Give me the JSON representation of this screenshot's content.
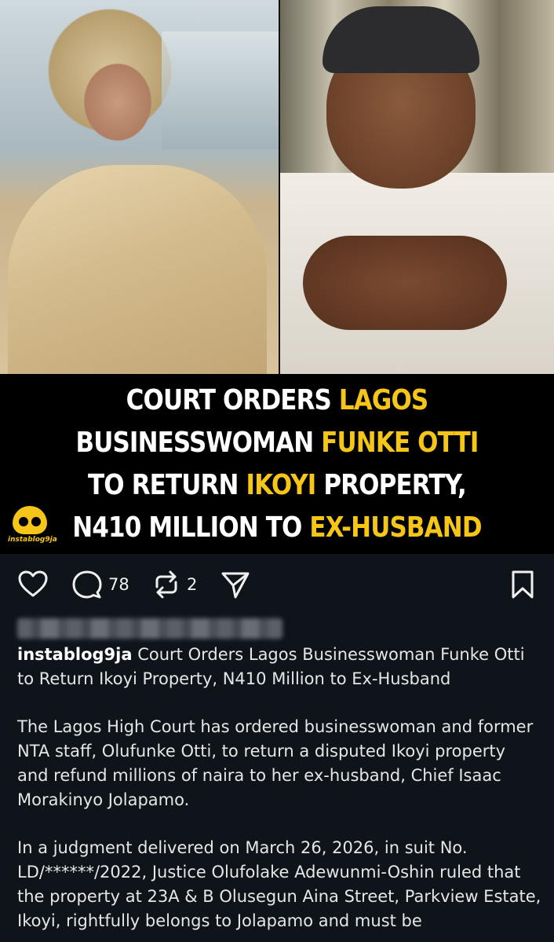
{
  "headline": {
    "line1_white": "COURT ORDERS ",
    "line1_yellow": "LAGOS",
    "line2_white": "BUSINESSWOMAN ",
    "line2_yellow": "FUNKE OTTI",
    "line3_white_a": "TO RETURN ",
    "line3_yellow": "IKOYI",
    "line3_white_b": " PROPERTY,",
    "line4_white": "N410 MILLION TO ",
    "line4_yellow": "EX-HUSBAND"
  },
  "logo": {
    "text": "instablog9ja"
  },
  "actions": {
    "comments_count": "78",
    "reposts_count": "2",
    "icons": [
      "heart-icon",
      "comment-icon",
      "repost-icon",
      "share-icon",
      "bookmark-icon"
    ]
  },
  "caption": {
    "username": "instablog9ja",
    "title": " Court Orders Lagos Businesswoman Funke Otti to Return Ikoyi Property, N410 Million to Ex-Husband",
    "paragraph1": "The Lagos High Court has ordered businesswoman and former NTA staff, Olufunke Otti, to return a disputed Ikoyi property and refund millions of naira to her ex-husband, Chief Isaac Morakinyo Jolapamo.",
    "paragraph2": "In a judgment delivered on March 26, 2026, in suit No. LD/******/2022, Justice Olufolake Adewunmi-Oshin ruled that the property at 23A & B Olusegun Aina Street, Parkview Estate, Ikoyi, rightfully belongs to Jolapamo and must be"
  },
  "colors": {
    "background": "#0f141b",
    "headline_accent": "#f5c518"
  }
}
